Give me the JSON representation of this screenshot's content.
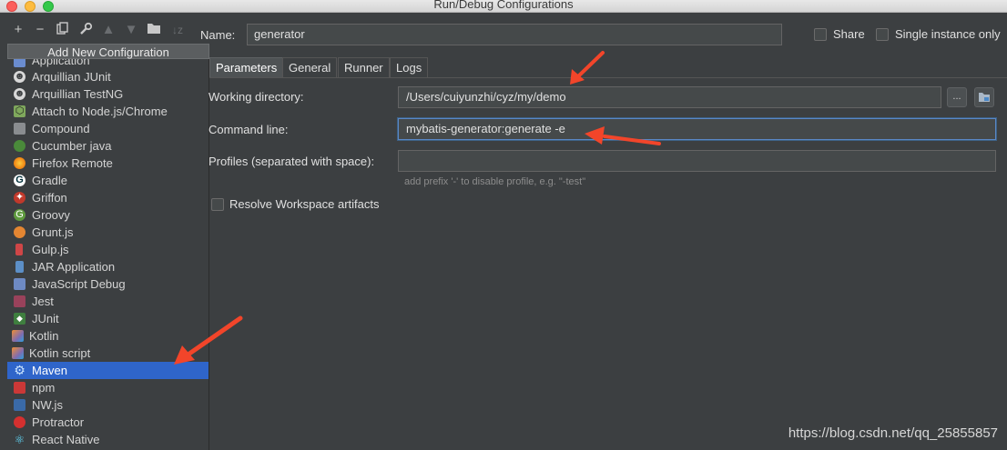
{
  "window": {
    "title": "Run/Debug Configurations"
  },
  "toolbar": {
    "icons": [
      "add-icon",
      "remove-icon",
      "copy-icon",
      "wrench-icon",
      "move-up-icon",
      "move-down-icon",
      "folder-icon",
      "sort-icon"
    ]
  },
  "popup": {
    "header": "Add New Configuration",
    "items": [
      {
        "label": "Application",
        "icon": "application-icon"
      },
      {
        "label": "Arquillian JUnit",
        "icon": "arquillian-icon"
      },
      {
        "label": "Arquillian TestNG",
        "icon": "arquillian-icon"
      },
      {
        "label": "Attach to Node.js/Chrome",
        "icon": "nodejs-icon"
      },
      {
        "label": "Compound",
        "icon": "compound-icon"
      },
      {
        "label": "Cucumber java",
        "icon": "cucumber-icon"
      },
      {
        "label": "Firefox Remote",
        "icon": "firefox-icon"
      },
      {
        "label": "Gradle",
        "icon": "gradle-icon"
      },
      {
        "label": "Griffon",
        "icon": "griffon-icon"
      },
      {
        "label": "Groovy",
        "icon": "groovy-icon"
      },
      {
        "label": "Grunt.js",
        "icon": "grunt-icon"
      },
      {
        "label": "Gulp.js",
        "icon": "gulp-icon"
      },
      {
        "label": "JAR Application",
        "icon": "jar-icon"
      },
      {
        "label": "JavaScript Debug",
        "icon": "javascript-debug-icon"
      },
      {
        "label": "Jest",
        "icon": "jest-icon"
      },
      {
        "label": "JUnit",
        "icon": "junit-icon"
      },
      {
        "label": "Kotlin",
        "icon": "kotlin-icon"
      },
      {
        "label": "Kotlin script",
        "icon": "kotlin-icon"
      },
      {
        "label": "Maven",
        "icon": "maven-gear-icon",
        "selected": true
      },
      {
        "label": "npm",
        "icon": "npm-icon"
      },
      {
        "label": "NW.js",
        "icon": "nwjs-icon"
      },
      {
        "label": "Protractor",
        "icon": "protractor-icon"
      },
      {
        "label": "React Native",
        "icon": "react-icon"
      }
    ]
  },
  "config": {
    "name_label": "Name:",
    "name_value": "generator",
    "share_label": "Share",
    "single_instance_label": "Single instance only"
  },
  "tabs": [
    {
      "label": "Parameters",
      "active": true
    },
    {
      "label": "General"
    },
    {
      "label": "Runner"
    },
    {
      "label": "Logs"
    }
  ],
  "parameters": {
    "working_dir_label": "Working directory:",
    "working_dir_value": "/Users/cuiyunzhi/cyz/my/demo",
    "browse_label": "...",
    "command_line_label": "Command line:",
    "command_line_value": "mybatis-generator:generate -e",
    "profiles_label": "Profiles (separated with space):",
    "profiles_value": "",
    "profiles_hint": "add prefix '-' to disable profile, e.g. \"-test\"",
    "resolve_label": "Resolve Workspace artifacts"
  },
  "watermark": "https://blog.csdn.net/qq_25855857",
  "colors": {
    "background": "#3c3f41",
    "selection": "#2f65ca",
    "annotation_arrow": "#f2452a"
  }
}
